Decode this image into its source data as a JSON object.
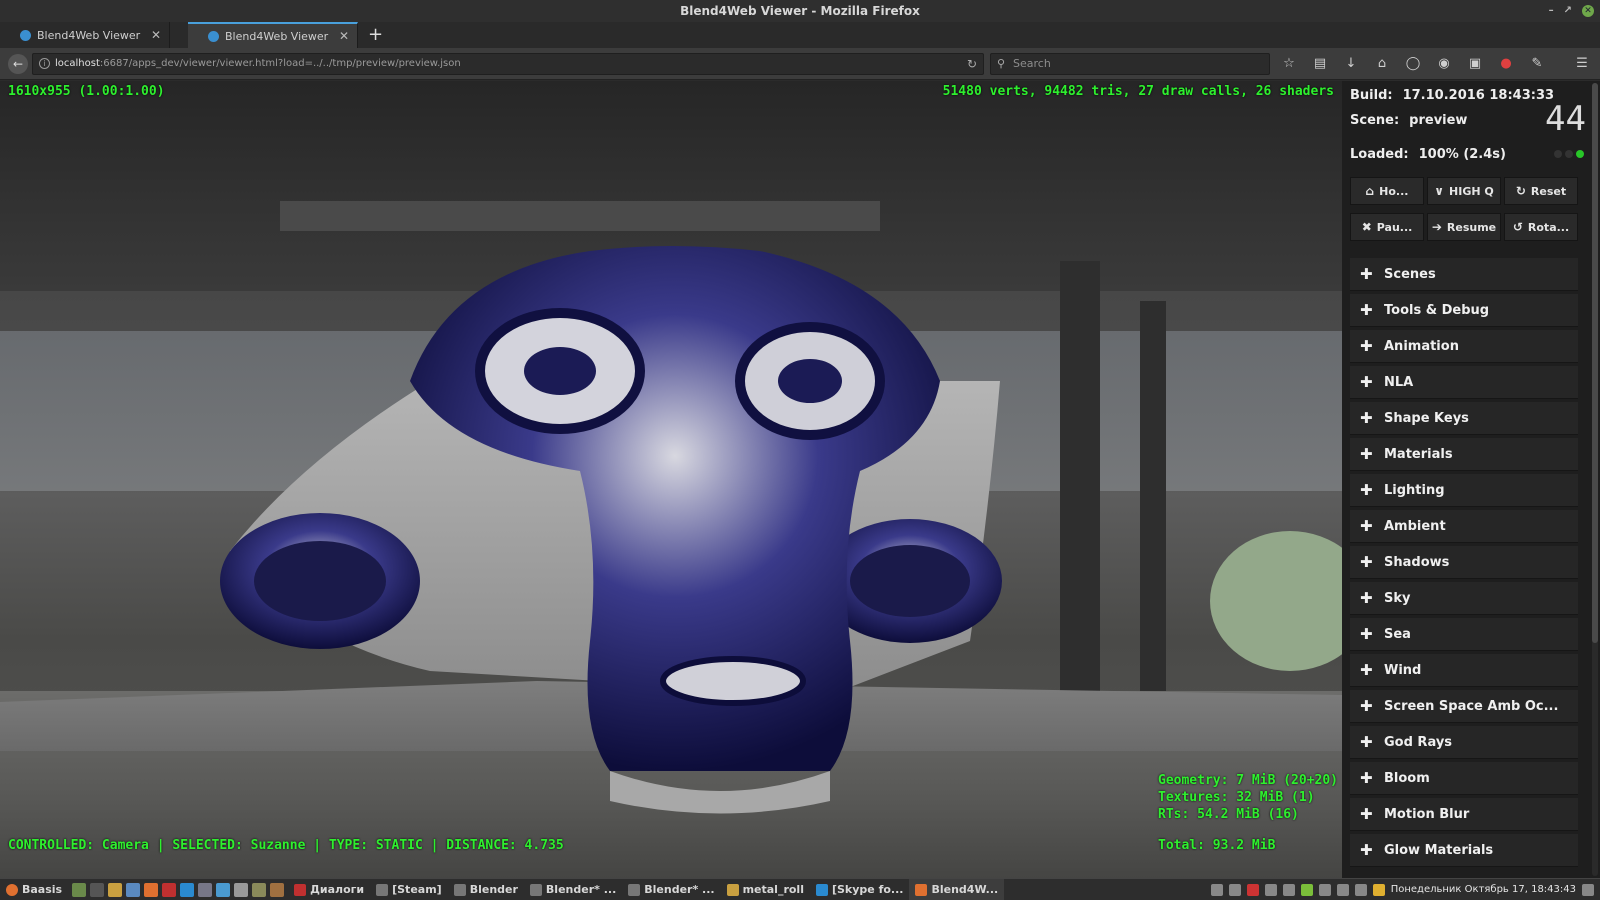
{
  "window": {
    "title": "Blend4Web Viewer - Mozilla Firefox"
  },
  "tabs": [
    {
      "label": "Blend4Web Viewer",
      "active": false
    },
    {
      "label": "Blend4Web Viewer",
      "active": true
    }
  ],
  "nav": {
    "url_host": "localhost",
    "url_rest": ":6687/apps_dev/viewer/viewer.html?load=../../tmp/preview/preview.json",
    "search_placeholder": "Search"
  },
  "hud": {
    "resolution": "1610x955 (1.00:1.00)",
    "render_stats": "51480 verts, 94482 tris, 27 draw calls, 26 shaders",
    "status_line": "CONTROLLED: Camera | SELECTED: Suzanne | TYPE: STATIC | DISTANCE: 4.735",
    "memory": {
      "geometry": "Geometry: 7 MiB (20+20)",
      "textures": "Textures: 32 MiB (1)",
      "rts": "RTs: 54.2 MiB (16)",
      "total": "Total: 93.2 MiB"
    },
    "color": "#2ef02e"
  },
  "panel": {
    "build_label": "Build:",
    "build_value": "17.10.2016 18:43:33",
    "scene_label": "Scene:",
    "scene_value": "preview",
    "fps": "44",
    "loaded_label": "Loaded:",
    "loaded_value": "100% (2.4s)",
    "buttons_row1": [
      {
        "label": "Ho...",
        "icon": "home-icon"
      },
      {
        "label": "HIGH Q",
        "icon": "chevron-down-icon"
      },
      {
        "label": "Reset",
        "icon": "refresh-icon"
      }
    ],
    "buttons_row2": [
      {
        "label": "Pau...",
        "icon": "close-icon"
      },
      {
        "label": "Resume",
        "icon": "arrow-right-icon"
      },
      {
        "label": "Rota...",
        "icon": "rotate-icon"
      }
    ],
    "sections": [
      "Scenes",
      "Tools & Debug",
      "Animation",
      "NLA",
      "Shape Keys",
      "Materials",
      "Lighting",
      "Ambient",
      "Shadows",
      "Sky",
      "Sea",
      "Wind",
      "Screen Space Amb Oc...",
      "God Rays",
      "Bloom",
      "Motion Blur",
      "Glow Materials"
    ]
  },
  "taskbar": {
    "start_label": "Baasis",
    "items": [
      {
        "label": "Диалоги",
        "active": false
      },
      {
        "label": "[Steam]",
        "active": false
      },
      {
        "label": "Blender",
        "active": false
      },
      {
        "label": "Blender* ...",
        "active": false
      },
      {
        "label": "Blender* ...",
        "active": false
      },
      {
        "label": "metal_roll",
        "active": false
      },
      {
        "label": "[Skype fo...",
        "active": false
      },
      {
        "label": "Blend4W...",
        "active": true
      }
    ],
    "clock": "Понедельник Октябрь 17, 18:43:43"
  }
}
